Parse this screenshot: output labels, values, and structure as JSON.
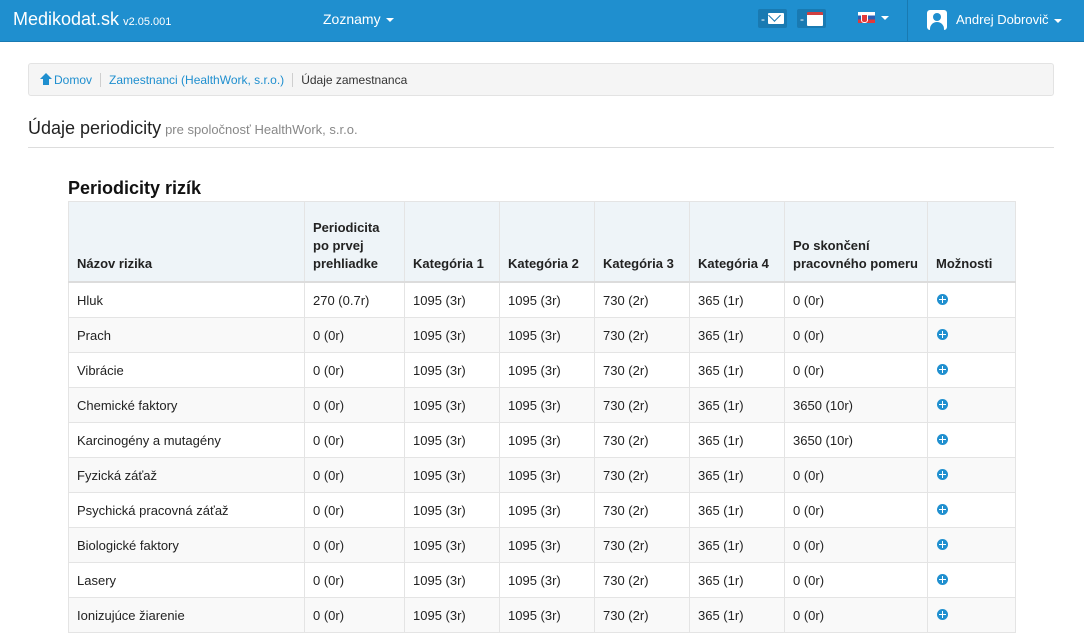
{
  "navbar": {
    "brand": "Medikodat.sk",
    "version": "v2.05.001",
    "menu_label": "Zoznamy",
    "messages_label": "-",
    "calendar_label": "-",
    "user_name": "Andrej Dobrovič"
  },
  "breadcrumb": {
    "home": "Domov",
    "employees": "Zamestnanci (HealthWork, s.r.o.)",
    "current": "Údaje zamestnanca"
  },
  "page": {
    "title": "Údaje periodicity",
    "subtitle": "pre spoločnosť HealthWork, s.r.o."
  },
  "section": {
    "title": "Periodicity rizík"
  },
  "table": {
    "headers": {
      "name": "Názov rizika",
      "first": "Periodicita po prvej prehliadke",
      "cat1": "Kategória 1",
      "cat2": "Kategória 2",
      "cat3": "Kategória 3",
      "cat4": "Kategória 4",
      "after": "Po skončení pracovného pomeru",
      "options": "Možnosti"
    },
    "rows": [
      {
        "name": "Hluk",
        "first": "270 (0.7r)",
        "cat1": "1095 (3r)",
        "cat2": "1095 (3r)",
        "cat3": "730 (2r)",
        "cat4": "365 (1r)",
        "after": "0 (0r)"
      },
      {
        "name": "Prach",
        "first": "0 (0r)",
        "cat1": "1095 (3r)",
        "cat2": "1095 (3r)",
        "cat3": "730 (2r)",
        "cat4": "365 (1r)",
        "after": "0 (0r)"
      },
      {
        "name": "Vibrácie",
        "first": "0 (0r)",
        "cat1": "1095 (3r)",
        "cat2": "1095 (3r)",
        "cat3": "730 (2r)",
        "cat4": "365 (1r)",
        "after": "0 (0r)"
      },
      {
        "name": "Chemické faktory",
        "first": "0 (0r)",
        "cat1": "1095 (3r)",
        "cat2": "1095 (3r)",
        "cat3": "730 (2r)",
        "cat4": "365 (1r)",
        "after": "3650 (10r)"
      },
      {
        "name": "Karcinogény a mutagény",
        "first": "0 (0r)",
        "cat1": "1095 (3r)",
        "cat2": "1095 (3r)",
        "cat3": "730 (2r)",
        "cat4": "365 (1r)",
        "after": "3650 (10r)"
      },
      {
        "name": "Fyzická záťaž",
        "first": "0 (0r)",
        "cat1": "1095 (3r)",
        "cat2": "1095 (3r)",
        "cat3": "730 (2r)",
        "cat4": "365 (1r)",
        "after": "0 (0r)"
      },
      {
        "name": "Psychická pracovná záťaž",
        "first": "0 (0r)",
        "cat1": "1095 (3r)",
        "cat2": "1095 (3r)",
        "cat3": "730 (2r)",
        "cat4": "365 (1r)",
        "after": "0 (0r)"
      },
      {
        "name": "Biologické faktory",
        "first": "0 (0r)",
        "cat1": "1095 (3r)",
        "cat2": "1095 (3r)",
        "cat3": "730 (2r)",
        "cat4": "365 (1r)",
        "after": "0 (0r)"
      },
      {
        "name": "Lasery",
        "first": "0 (0r)",
        "cat1": "1095 (3r)",
        "cat2": "1095 (3r)",
        "cat3": "730 (2r)",
        "cat4": "365 (1r)",
        "after": "0 (0r)"
      },
      {
        "name": "Ionizujúce žiarenie",
        "first": "0 (0r)",
        "cat1": "1095 (3r)",
        "cat2": "1095 (3r)",
        "cat3": "730 (2r)",
        "cat4": "365 (1r)",
        "after": "0 (0r)"
      }
    ]
  },
  "colors": {
    "navbar": "#1f8fcf",
    "link": "#1f8fcf"
  }
}
